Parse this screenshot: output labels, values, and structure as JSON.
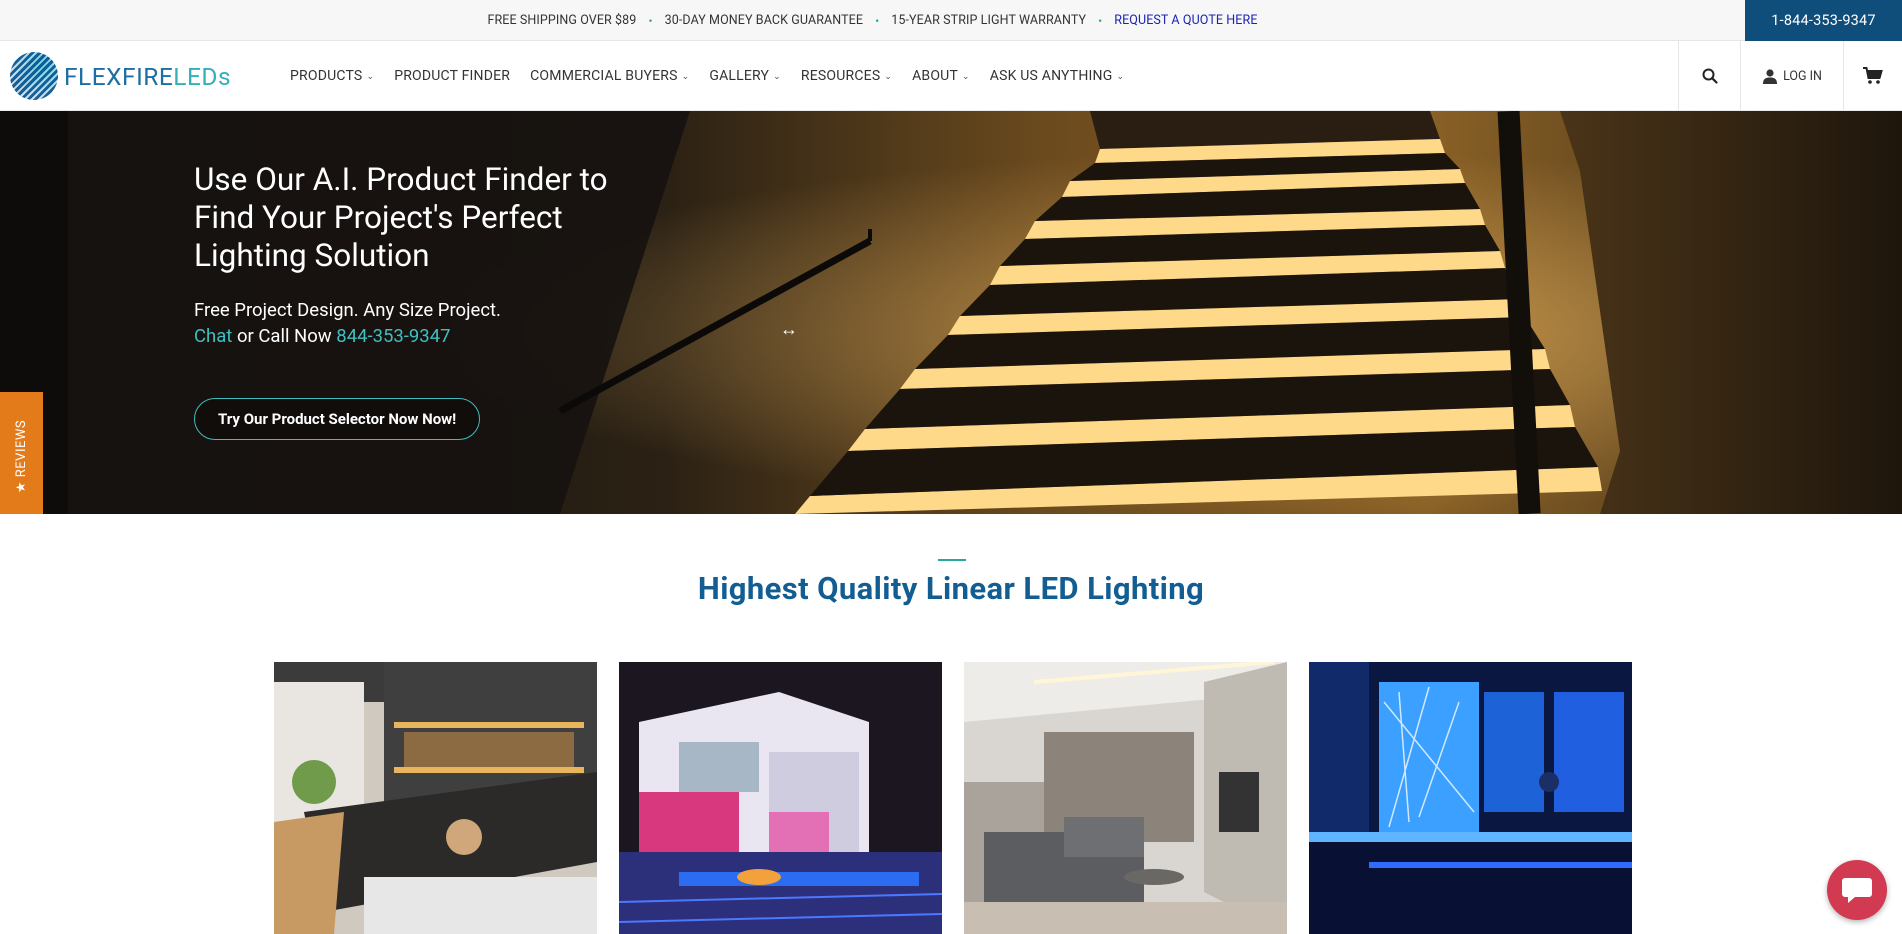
{
  "topbar": {
    "messages": [
      "FREE SHIPPING OVER $89",
      "30-DAY MONEY BACK GUARANTEE",
      "15-YEAR STRIP LIGHT WARRANTY"
    ],
    "quote_link": "REQUEST A QUOTE HERE",
    "phone": "1-844-353-9347"
  },
  "header": {
    "logo": {
      "part1": "FLEXFIRE",
      "part2": "LEDs"
    },
    "nav": [
      {
        "label": "PRODUCTS",
        "dropdown": true
      },
      {
        "label": "PRODUCT FINDER",
        "dropdown": false
      },
      {
        "label": "COMMERCIAL BUYERS",
        "dropdown": true
      },
      {
        "label": "GALLERY",
        "dropdown": true
      },
      {
        "label": "RESOURCES",
        "dropdown": true
      },
      {
        "label": "ABOUT",
        "dropdown": true
      },
      {
        "label": "ASK US ANYTHING",
        "dropdown": true
      }
    ],
    "login_label": "LOG IN"
  },
  "hero": {
    "title": "Use Our A.I. Product Finder to Find Your Project's Perfect Lighting Solution",
    "sub_line1": "Free Project Design. Any Size Project.",
    "chat_link": "Chat",
    "call_text": " or Call Now ",
    "phone_link": "844-353-9347",
    "cta_label": "Try Our Product Selector Now Now!"
  },
  "reviews_tab": "★ REVIEWS",
  "section": {
    "title": "Highest Quality Linear LED Lighting"
  },
  "cards": [
    "kitchen-image",
    "outdoor-patio-image",
    "living-room-image",
    "bar-image"
  ],
  "colors": {
    "brand_blue": "#0f4d7a",
    "heading_blue": "#125d92",
    "teal": "#2aa6a6",
    "reviews_orange": "#e37b1a",
    "chat_red": "#d13a50"
  }
}
